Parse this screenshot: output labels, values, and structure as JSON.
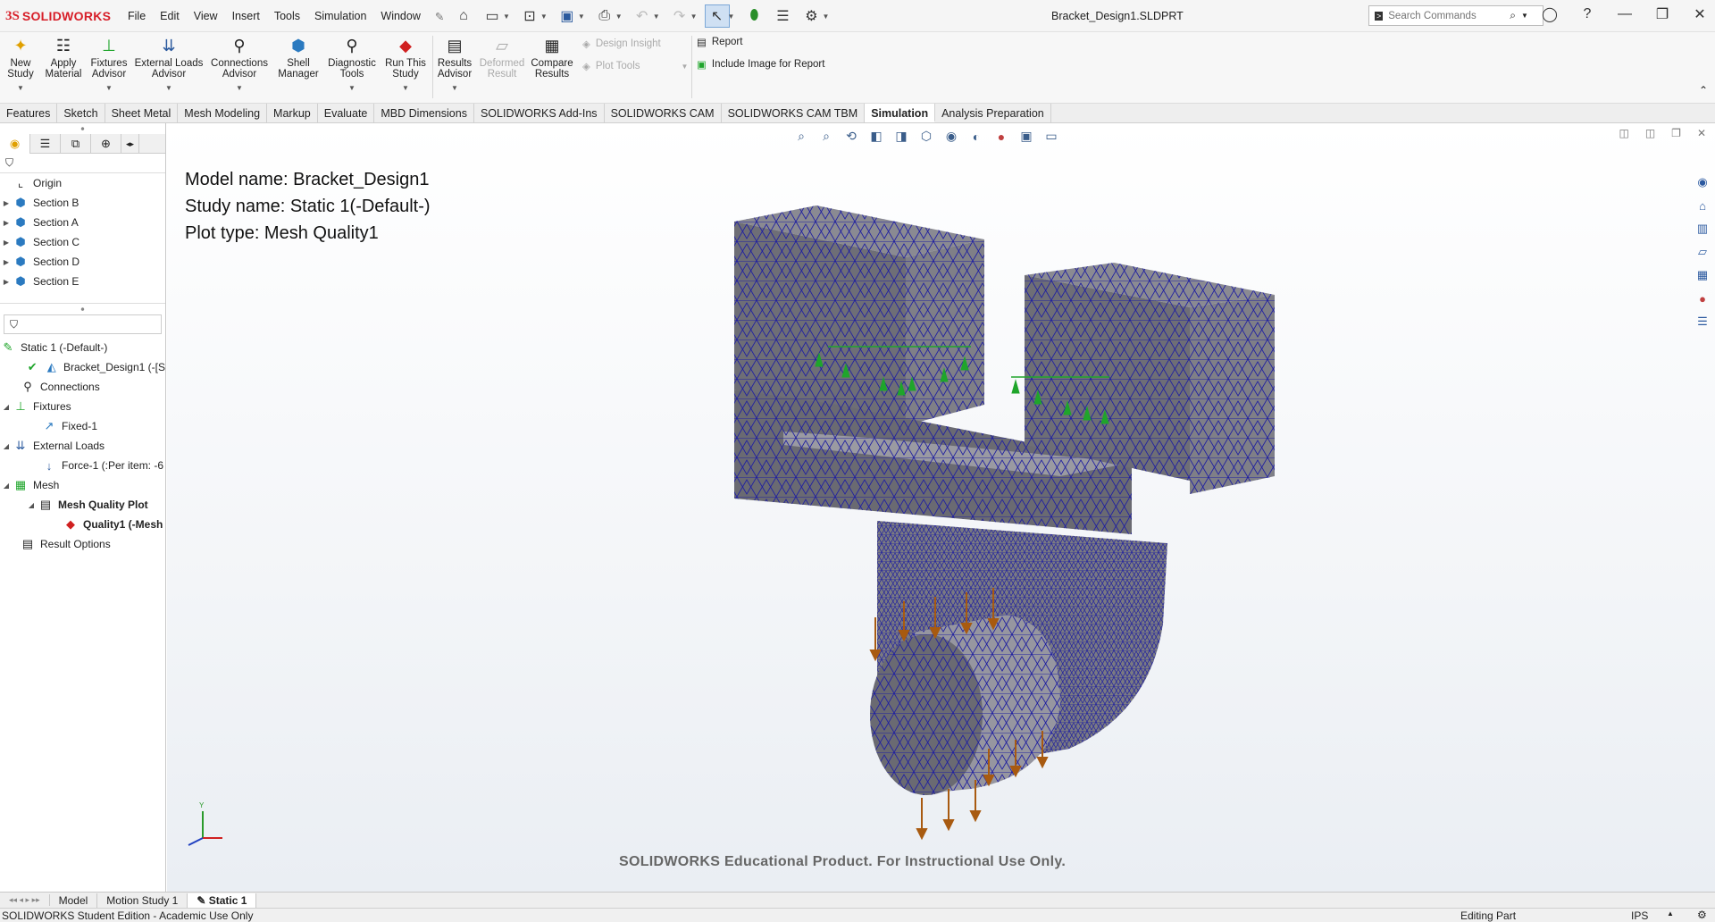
{
  "app": {
    "logo_ds": "3S",
    "logo_text": "SOLIDWORKS",
    "document_title": "Bracket_Design1.SLDPRT"
  },
  "menu": [
    "File",
    "Edit",
    "View",
    "Insert",
    "Tools",
    "Simulation",
    "Window"
  ],
  "search": {
    "placeholder": "Search Commands"
  },
  "ribbon": {
    "buttons": [
      {
        "label": "New\nStudy",
        "icon": "new-study-icon"
      },
      {
        "label": "Apply\nMaterial",
        "icon": "apply-material-icon"
      },
      {
        "label": "Fixtures\nAdvisor",
        "icon": "fixtures-advisor-icon"
      },
      {
        "label": "External Loads\nAdvisor",
        "icon": "external-loads-icon"
      },
      {
        "label": "Connections\nAdvisor",
        "icon": "connections-icon"
      },
      {
        "label": "Shell\nManager",
        "icon": "shell-manager-icon"
      },
      {
        "label": "Diagnostic\nTools",
        "icon": "diagnostic-icon"
      },
      {
        "label": "Run This\nStudy",
        "icon": "run-study-icon"
      },
      {
        "label": "Results\nAdvisor",
        "icon": "results-advisor-icon"
      },
      {
        "label": "Deformed\nResult",
        "icon": "deformed-result-icon"
      },
      {
        "label": "Compare\nResults",
        "icon": "compare-results-icon"
      }
    ],
    "design_insight": "Design Insight",
    "plot_tools": "Plot Tools",
    "report": "Report",
    "include_image": "Include Image for Report"
  },
  "tabs": [
    "Features",
    "Sketch",
    "Sheet Metal",
    "Mesh Modeling",
    "Markup",
    "Evaluate",
    "MBD Dimensions",
    "SOLIDWORKS Add-Ins",
    "SOLIDWORKS CAM",
    "SOLIDWORKS CAM TBM",
    "Simulation",
    "Analysis Preparation"
  ],
  "active_tab": "Simulation",
  "feature_tree": [
    "Origin",
    "Section B",
    "Section A",
    "Section C",
    "Section D",
    "Section E"
  ],
  "study_tree": {
    "study": "Static 1 (-Default-)",
    "part": "Bracket_Design1 (-[S",
    "connections": "Connections",
    "fixtures": "Fixtures",
    "fixed": "Fixed-1",
    "external_loads": "External Loads",
    "force": "Force-1 (:Per item: -6",
    "mesh": "Mesh",
    "mesh_plot": "Mesh Quality Plot",
    "quality": "Quality1 (-Mesh",
    "result_options": "Result Options"
  },
  "viewport": {
    "model_name": "Model name: Bracket_Design1",
    "study_name": "Study name: Static 1(-Default-)",
    "plot_type": "Plot type: Mesh Quality1",
    "watermark": "SOLIDWORKS Educational Product. For Instructional Use Only.",
    "triad_y": "Y",
    "mesh_color": "#2020a0",
    "body_color": "#6e6e76",
    "fixture_color": "#1fa52b",
    "force_color": "#a85a10"
  },
  "bottom_tabs": [
    "Model",
    "Motion Study 1",
    "Static 1"
  ],
  "status": {
    "left": "SOLIDWORKS Student Edition - Academic Use Only",
    "mode": "Editing Part",
    "units": "IPS"
  }
}
